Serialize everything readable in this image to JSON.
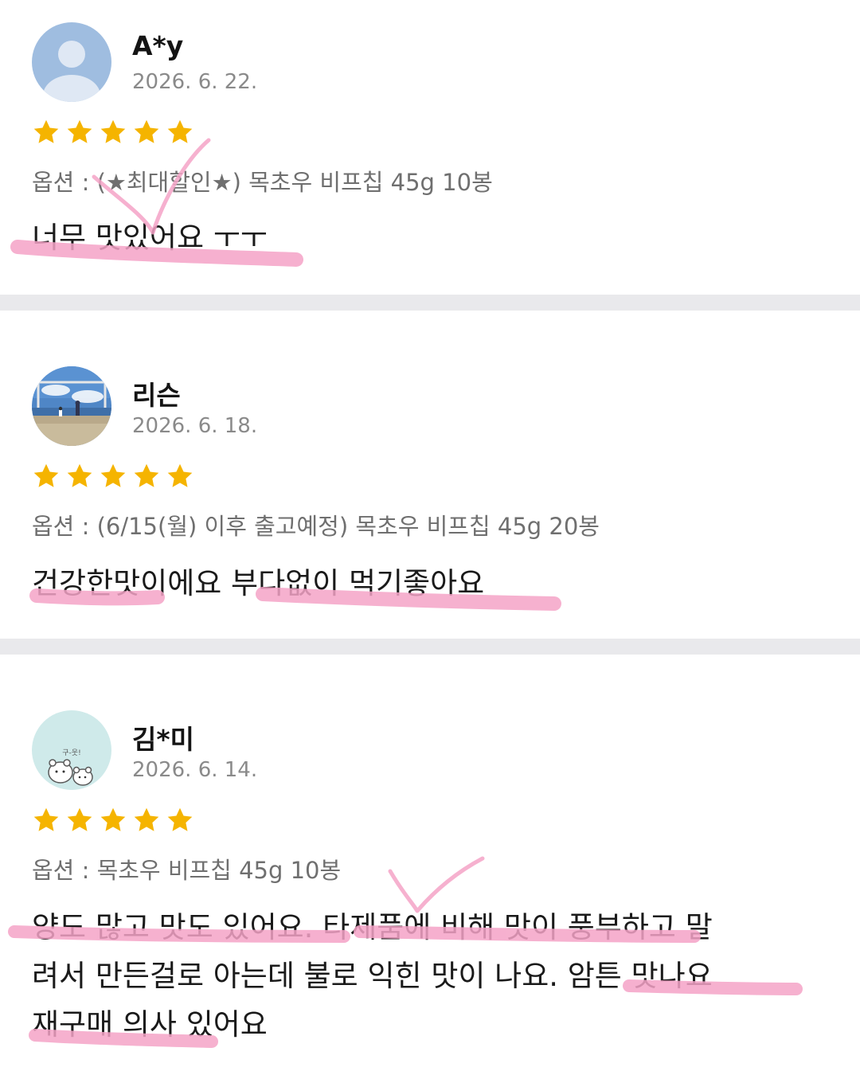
{
  "reviews": [
    {
      "author": "A*y",
      "date": "2026. 6. 22.",
      "rating": 5,
      "avatar": "default-person-avatar",
      "option": "옵션 : (★최대할인★) 목초우 비프칩 45g 10봉",
      "lines": [
        "너무 맛있어요 ㅜㅜ"
      ]
    },
    {
      "author": "리슨",
      "date": "2026. 6. 18.",
      "rating": 5,
      "avatar": "landscape-photo-avatar",
      "option": "옵션 : (6/15(월) 이후 출고예정) 목초우 비프칩 45g 20봉",
      "lines": [
        "건강한맛이에요 부다없이 먹기좋아요"
      ]
    },
    {
      "author": "김*미",
      "date": "2026. 6. 14.",
      "rating": 5,
      "avatar": "cartoon-animals-avatar",
      "avatar_caption": "구-웃!",
      "option": "옵션 : 목초우 비프칩 45g 10봉",
      "lines": [
        "양도 많고 맛도 있어요. 타제품에 비해 맛이 풍부하고 말",
        "려서 만든걸로 아는데 불로 익힌 맛이 나요. 암튼 맛나요",
        "재구매 의사 있어요"
      ]
    }
  ],
  "colors": {
    "star": "#F5B400",
    "highlight": "#F5A3C7",
    "divider": "#E9E9EC",
    "date": "#8A8A8A",
    "option": "#6F6F6F"
  }
}
